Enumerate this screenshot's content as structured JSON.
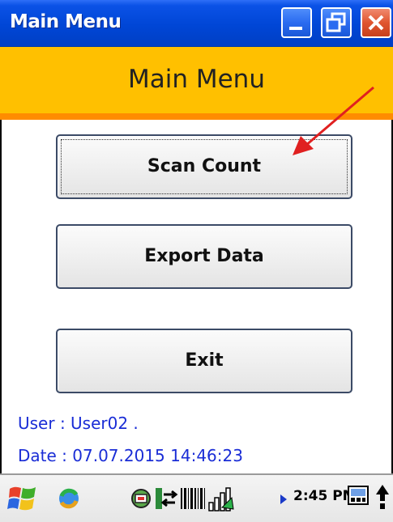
{
  "window": {
    "title": "Main Menu",
    "controls": [
      "minimize",
      "maximize",
      "close"
    ]
  },
  "header": {
    "title": "Main Menu"
  },
  "menu": {
    "buttons": [
      {
        "label": "Scan Count",
        "focused": true
      },
      {
        "label": "Export Data",
        "focused": false
      },
      {
        "label": "Exit",
        "focused": false
      }
    ]
  },
  "info": {
    "user": "User : User02 .",
    "date": "Date : 07.07.2015 14:46:23"
  },
  "taskbar": {
    "clock": "2:45 PM",
    "icons": [
      "windows-start-icon",
      "sync-icon",
      "network-icon",
      "connection-icon",
      "barcode-icon",
      "signal-icon",
      "expand-arrow-icon",
      "keyboard-icon",
      "input-panel-icon",
      "up-arrow-icon"
    ]
  },
  "colors": {
    "titlebar": "#0046d6",
    "header_bg": "#ffc000",
    "header_stripe": "#ff8c00",
    "info_text": "#1a2dd6",
    "annotation_arrow": "#e02020"
  }
}
